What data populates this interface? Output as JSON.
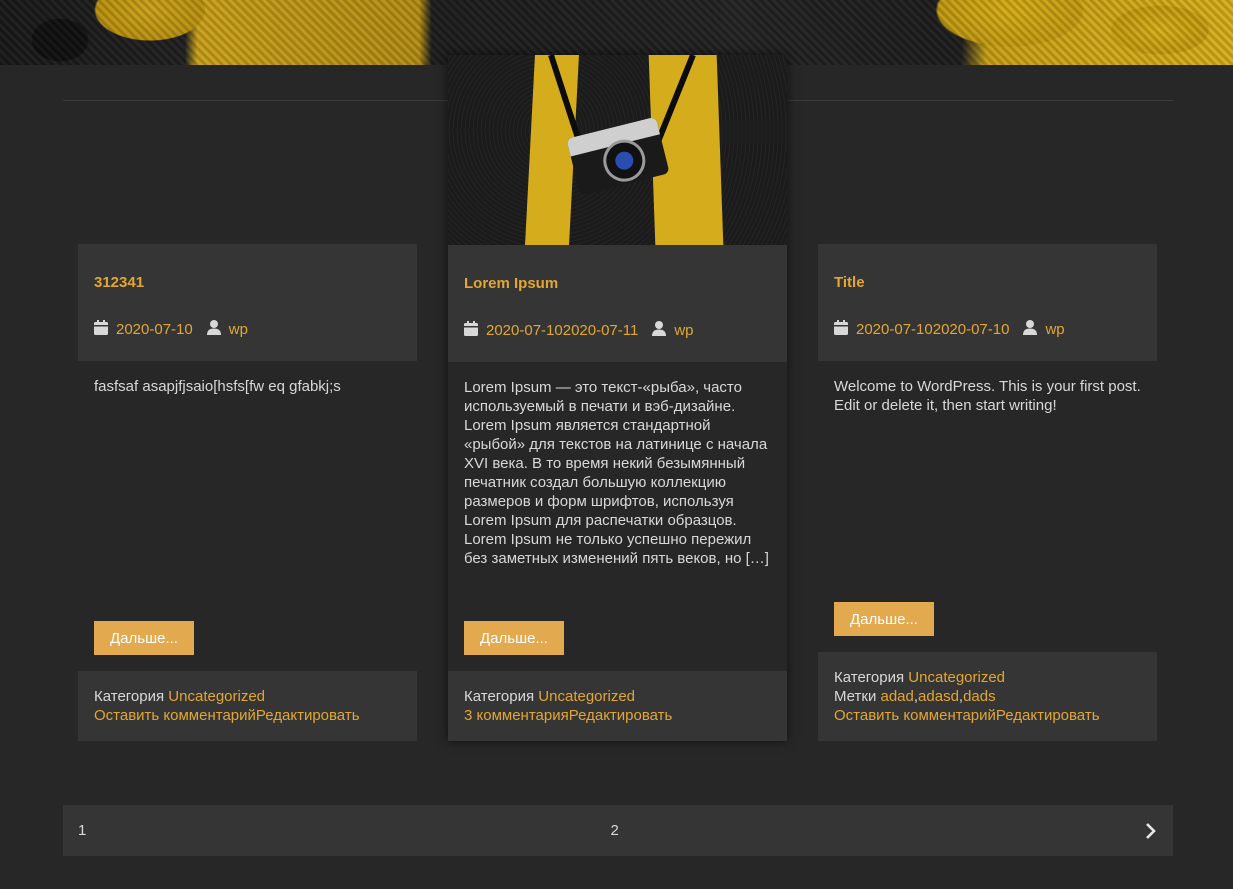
{
  "posts": [
    {
      "title": "312341",
      "date": "2020-07-10",
      "author": "wp",
      "excerpt": "fasfsaf asapjfjsaio[hsfs[fw eq gfabkj;s",
      "more_label": "Дальше...",
      "category_label": "Категория",
      "category": "Uncategorized",
      "comments_link": "Оставить комментарий",
      "edit_link": "Редактировать"
    },
    {
      "title": "Lorem Ipsum",
      "date": "2020-07-102020-07-11",
      "author": "wp",
      "excerpt": "Lorem Ipsum — это текст-«рыба», часто используемый в печати и вэб-дизайне. Lorem Ipsum является стандартной «рыбой» для текстов на латинице с начала XVI века. В то время некий безымянный печатник создал большую коллекцию размеров и форм шрифтов, используя Lorem Ipsum для распечатки образцов. Lorem Ipsum не только успешно пережил без заметных изменений пять веков, но […]",
      "more_label": "Дальше...",
      "category_label": "Категория",
      "category": "Uncategorized",
      "comments_link": "3 комментария",
      "edit_link": "Редактировать"
    },
    {
      "title": "Title",
      "date": "2020-07-102020-07-10",
      "author": "wp",
      "excerpt": "Welcome to WordPress. This is your first post. Edit or delete it, then start writing!",
      "more_label": "Дальше...",
      "category_label": "Категория",
      "category": "Uncategorized",
      "tags_label": "Метки",
      "tags": [
        "adad",
        "adasd",
        "dads"
      ],
      "comments_link": "Оставить комментарий",
      "edit_link": "Редактировать"
    }
  ],
  "pagination": {
    "page1": "1",
    "page2": "2",
    "next_icon": "chevron-right-icon"
  },
  "colors": {
    "background": "#272727",
    "panel": "#353535",
    "accent": "#e3a731",
    "button": "#e3a94f"
  }
}
